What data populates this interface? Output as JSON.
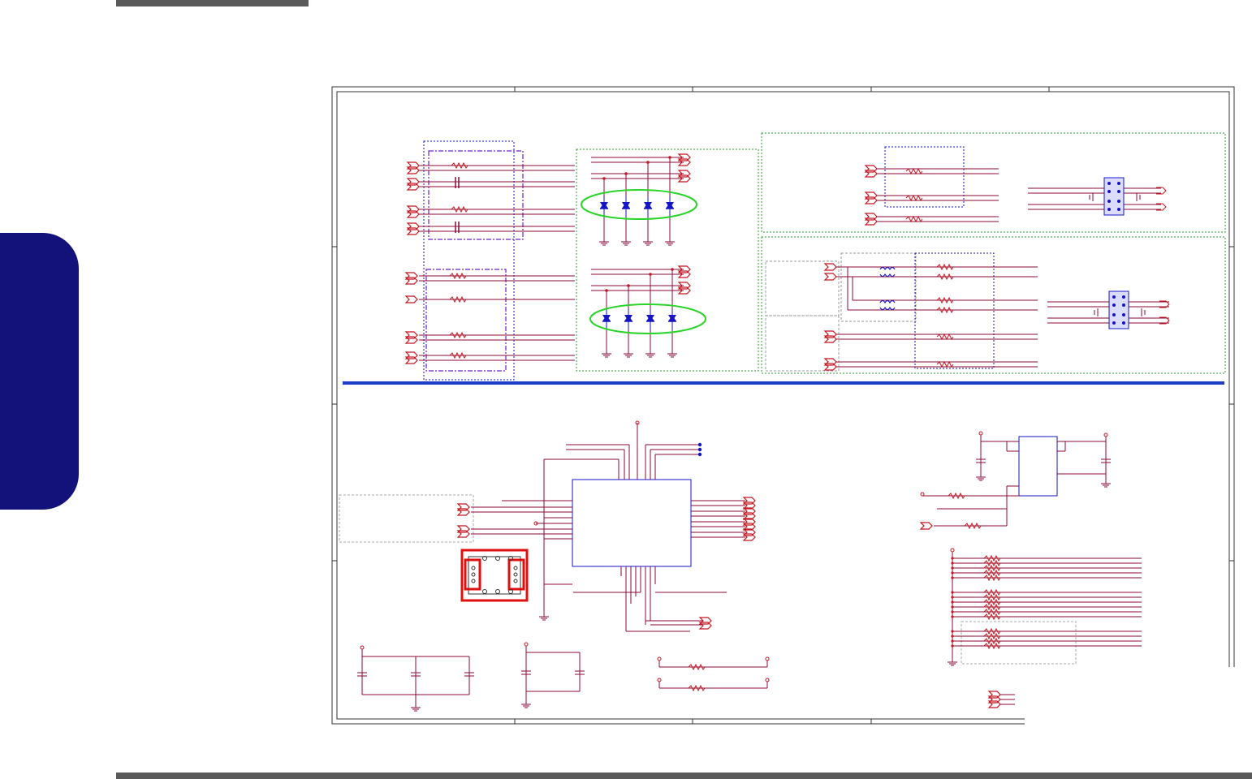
{
  "page": {
    "chapter_tab_text": "",
    "page_number": ""
  },
  "schematic": {
    "description_text": "",
    "colors": {
      "wire": "#8b0a34",
      "connector": "#c41620",
      "component": "#1515c8",
      "group_box": "#2d9a2d",
      "sub_box": "#6a20d0",
      "bus_line": "#1e3ec8",
      "highlight_oval": "#2ad42a",
      "highlight_box": "#e01010",
      "frame": "#333333",
      "tab": "#13127a",
      "bar": "#5a5a5a"
    }
  }
}
